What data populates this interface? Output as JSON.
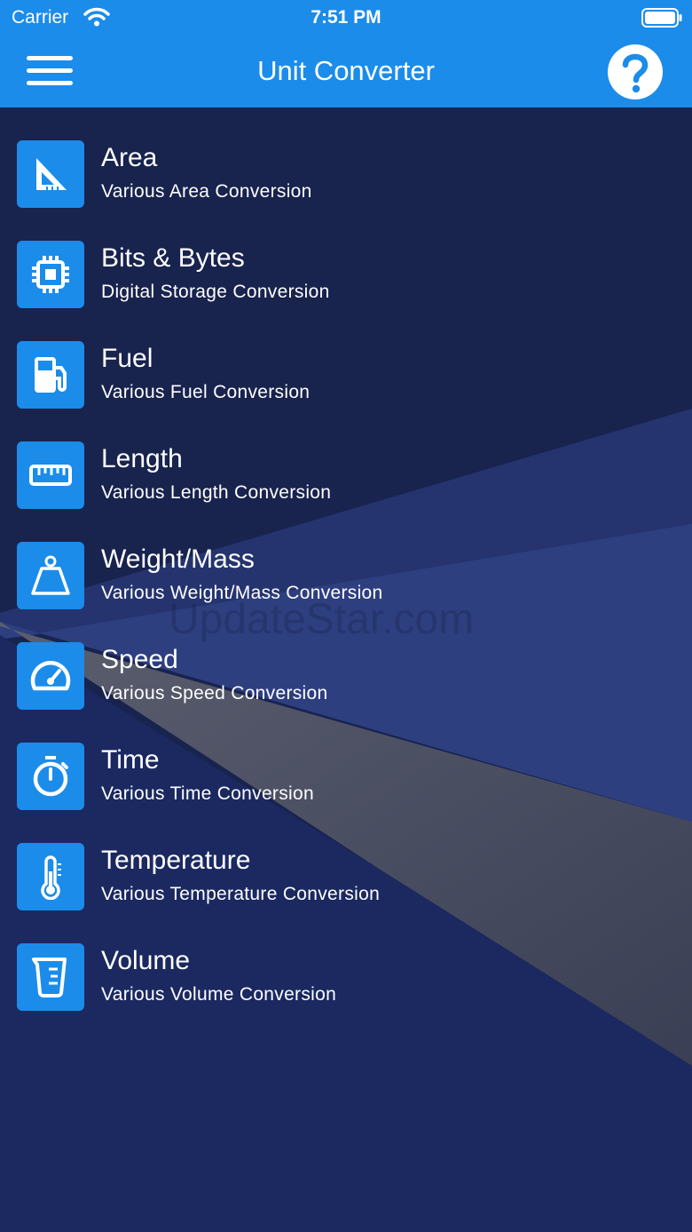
{
  "status_bar": {
    "carrier": "Carrier",
    "time": "7:51 PM"
  },
  "header": {
    "title": "Unit Converter"
  },
  "watermark": "UpdateStar.com",
  "colors": {
    "accent": "#1b8cea",
    "background": "#18234e"
  },
  "items": [
    {
      "name": "Area",
      "description": "Various Area Conversion",
      "icon": "set-square-icon"
    },
    {
      "name": "Bits & Bytes",
      "description": "Digital Storage Conversion",
      "icon": "chip-icon"
    },
    {
      "name": "Fuel",
      "description": "Various Fuel Conversion",
      "icon": "fuel-pump-icon"
    },
    {
      "name": "Length",
      "description": "Various Length Conversion",
      "icon": "ruler-icon"
    },
    {
      "name": "Weight/Mass",
      "description": "Various Weight/Mass Conversion",
      "icon": "weight-icon"
    },
    {
      "name": "Speed",
      "description": "Various Speed Conversion",
      "icon": "speedometer-icon"
    },
    {
      "name": "Time",
      "description": "Various Time Conversion",
      "icon": "stopwatch-icon"
    },
    {
      "name": "Temperature",
      "description": "Various Temperature Conversion",
      "icon": "thermometer-icon"
    },
    {
      "name": "Volume",
      "description": "Various Volume Conversion",
      "icon": "measuring-cup-icon"
    }
  ]
}
